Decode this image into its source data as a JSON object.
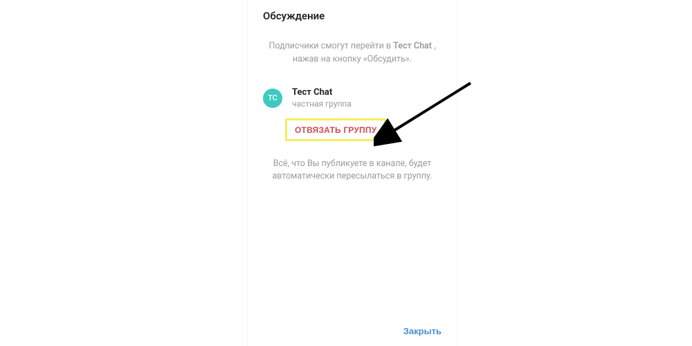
{
  "modal": {
    "title": "Обсуждение",
    "description_prefix": "Подписчики смогут перейти в ",
    "description_bold": "Тест Chat",
    "description_suffix": " , нажав на кнопку «Обсудить».",
    "group": {
      "avatar_initials": "ТС",
      "name": "Тест Chat",
      "type": "частная группа"
    },
    "unlink_label": "ОТВЯЗАТЬ ГРУППУ",
    "footer": "Всё, что Вы публикуете в канале, будет автоматически пересылаться в группу.",
    "close_label": "Закрыть"
  },
  "colors": {
    "avatar_bg": "#3fc9c1",
    "unlink_text": "#d14b4b",
    "highlight_border": "#f6ed5f",
    "close_text": "#4a90d9"
  }
}
